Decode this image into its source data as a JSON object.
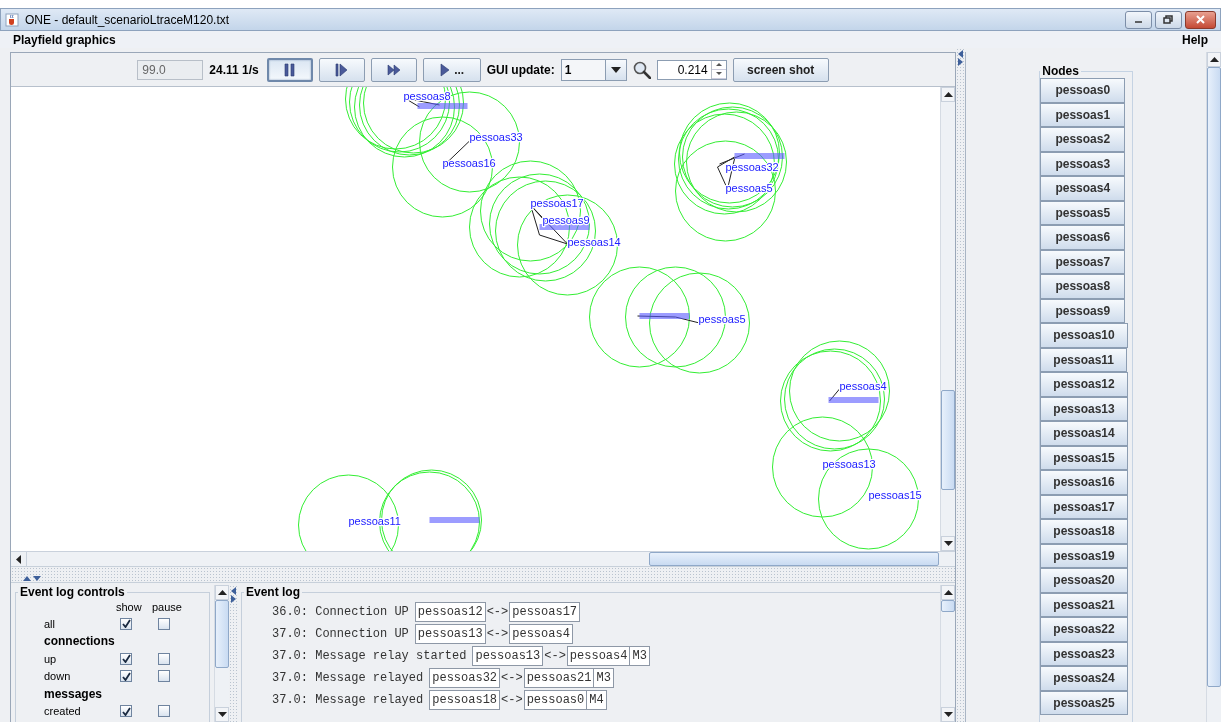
{
  "window": {
    "title": "ONE - default_scenarioLtraceM120.txt"
  },
  "menu_bar": {
    "left": "Playfield graphics",
    "right": "Help"
  },
  "toolbar": {
    "sim_time": "99.0",
    "speed": "24.11 1/s",
    "play_buttons": [
      {
        "kind": "pause",
        "selected": true
      },
      {
        "kind": "step",
        "selected": false
      },
      {
        "kind": "fast_forward",
        "selected": false
      },
      {
        "kind": "play_until",
        "label": "...",
        "selected": false
      }
    ],
    "gui_update_label": "GUI update:",
    "gui_update_value": "1",
    "zoom_value": "0.214",
    "screenshot_button": "screen shot"
  },
  "playfield": {
    "node_labels": [
      "pessoas8",
      "pessoas33",
      "pessoas16",
      "pessoas17",
      "pessoas9",
      "pessoas14",
      "pessoas32",
      "pessoas5",
      "pessoas5",
      "pessoas4",
      "pessoas13",
      "pessoas15",
      "pessoas11"
    ]
  },
  "event_log_controls": {
    "title": "Event log controls",
    "columns": [
      "show",
      "pause"
    ],
    "rows": [
      {
        "kind": "option",
        "label": "all",
        "show": true,
        "pause": false
      },
      {
        "kind": "section",
        "label": "connections"
      },
      {
        "kind": "option",
        "label": "up",
        "show": true,
        "pause": false
      },
      {
        "kind": "option",
        "label": "down",
        "show": true,
        "pause": false
      },
      {
        "kind": "section",
        "label": "messages"
      },
      {
        "kind": "option",
        "label": "created",
        "show": true,
        "pause": false
      }
    ]
  },
  "event_log": {
    "title": "Event log",
    "entries": [
      {
        "text": "36.0: Connection UP",
        "parts": [
          {
            "kind": "node",
            "text": "pessoas12"
          },
          {
            "kind": "separator",
            "text": "<->"
          },
          {
            "kind": "node",
            "text": "pessoas17"
          }
        ]
      },
      {
        "text": "37.0: Connection UP",
        "parts": [
          {
            "kind": "node",
            "text": "pessoas13"
          },
          {
            "kind": "separator",
            "text": "<->"
          },
          {
            "kind": "node",
            "text": "pessoas4"
          }
        ]
      },
      {
        "text": "37.0: Message relay started",
        "parts": [
          {
            "kind": "node",
            "text": "pessoas13"
          },
          {
            "kind": "separator",
            "text": "<->"
          },
          {
            "kind": "node",
            "text": "pessoas4"
          },
          {
            "kind": "message",
            "text": "M3"
          }
        ]
      },
      {
        "text": "37.0: Message relayed",
        "parts": [
          {
            "kind": "node",
            "text": "pessoas32"
          },
          {
            "kind": "separator",
            "text": "<->"
          },
          {
            "kind": "node",
            "text": "pessoas21"
          },
          {
            "kind": "message",
            "text": "M3"
          }
        ]
      },
      {
        "text": "37.0: Message relayed",
        "parts": [
          {
            "kind": "node",
            "text": "pessoas18"
          },
          {
            "kind": "separator",
            "text": "<->"
          },
          {
            "kind": "node",
            "text": "pessoas0"
          },
          {
            "kind": "message",
            "text": "M4"
          }
        ]
      }
    ]
  },
  "nodes": {
    "title": "Nodes",
    "buttons": [
      "pessoas0",
      "pessoas1",
      "pessoas2",
      "pessoas3",
      "pessoas4",
      "pessoas5",
      "pessoas6",
      "pessoas7",
      "pessoas8",
      "pessoas9",
      "pessoas10",
      "pessoas11",
      "pessoas12",
      "pessoas13",
      "pessoas14",
      "pessoas15",
      "pessoas16",
      "pessoas17",
      "pessoas18",
      "pessoas19",
      "pessoas20",
      "pessoas21",
      "pessoas22",
      "pessoas23",
      "pessoas24",
      "pessoas25"
    ]
  }
}
